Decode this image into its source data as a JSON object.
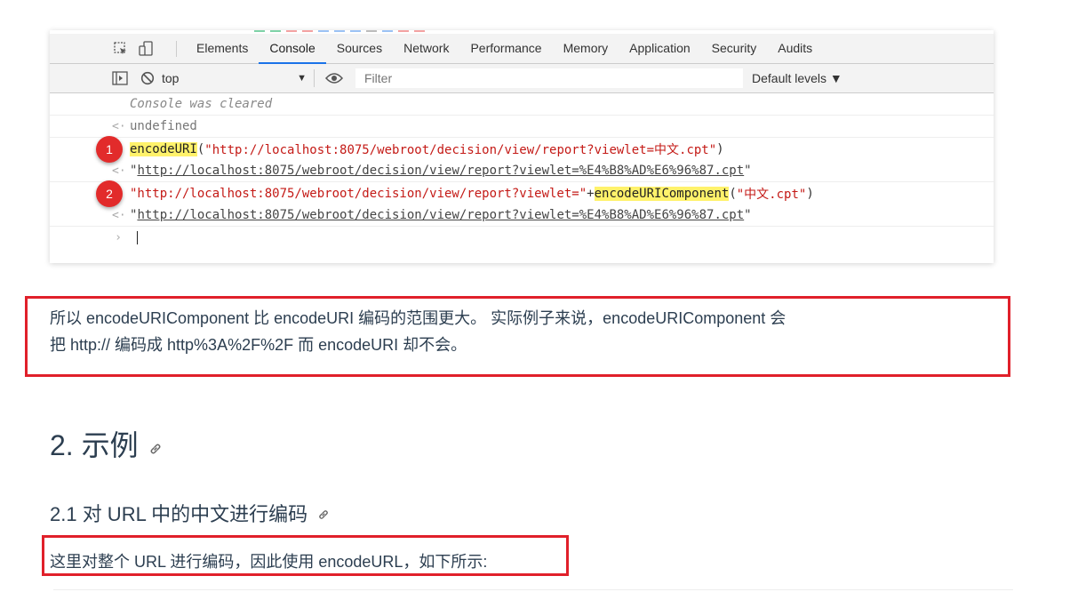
{
  "devtools": {
    "tabs": [
      "Elements",
      "Console",
      "Sources",
      "Network",
      "Performance",
      "Memory",
      "Application",
      "Security",
      "Audits"
    ],
    "active_tab": "Console",
    "context": "top",
    "filter_placeholder": "Filter",
    "levels_label": "Default levels ▼",
    "console": {
      "cleared": "Console was cleared",
      "undefined": "undefined",
      "cmd1_fn": "encodeURI",
      "cmd1_open": "(",
      "cmd1_arg": "\"http://localhost:8075/webroot/decision/view/report?viewlet=中文.cpt\"",
      "cmd1_close": ")",
      "res1_q1": "\"",
      "res1_url": "http://localhost:8075/webroot/decision/view/report?viewlet=%E4%B8%AD%E6%96%87.cpt",
      "res1_q2": "\"",
      "cmd2_str": "\"http://localhost:8075/webroot/decision/view/report?viewlet=\"",
      "cmd2_plus": "+",
      "cmd2_fn": "encodeURIComponent",
      "cmd2_open": "(",
      "cmd2_arg": "\"中文.cpt\"",
      "cmd2_close": ")",
      "res2_q1": "\"",
      "res2_url": "http://localhost:8075/webroot/decision/view/report?viewlet=%E4%B8%AD%E6%96%87.cpt",
      "res2_q2": "\"",
      "badge1": "1",
      "badge2": "2"
    }
  },
  "article": {
    "para_line1": "所以 encodeURIComponent 比 encodeURI 编码的范围更大。 实际例子来说，encodeURIComponent 会",
    "para_line2": "把 http:// 编码成 http%3A%2F%2F 而 encodeURI 却不会。",
    "section_title": "2. 示例",
    "subsection_title": "2.1 对 URL 中的中文进行编码",
    "p2": "这里对整个 URL 进行编码，因此使用 encodeURL，如下所示:"
  },
  "colors": {
    "accent_red": "#e0202a",
    "tab_active": "#1a73e8",
    "highlight": "#fff26b",
    "string": "#c41a16"
  }
}
